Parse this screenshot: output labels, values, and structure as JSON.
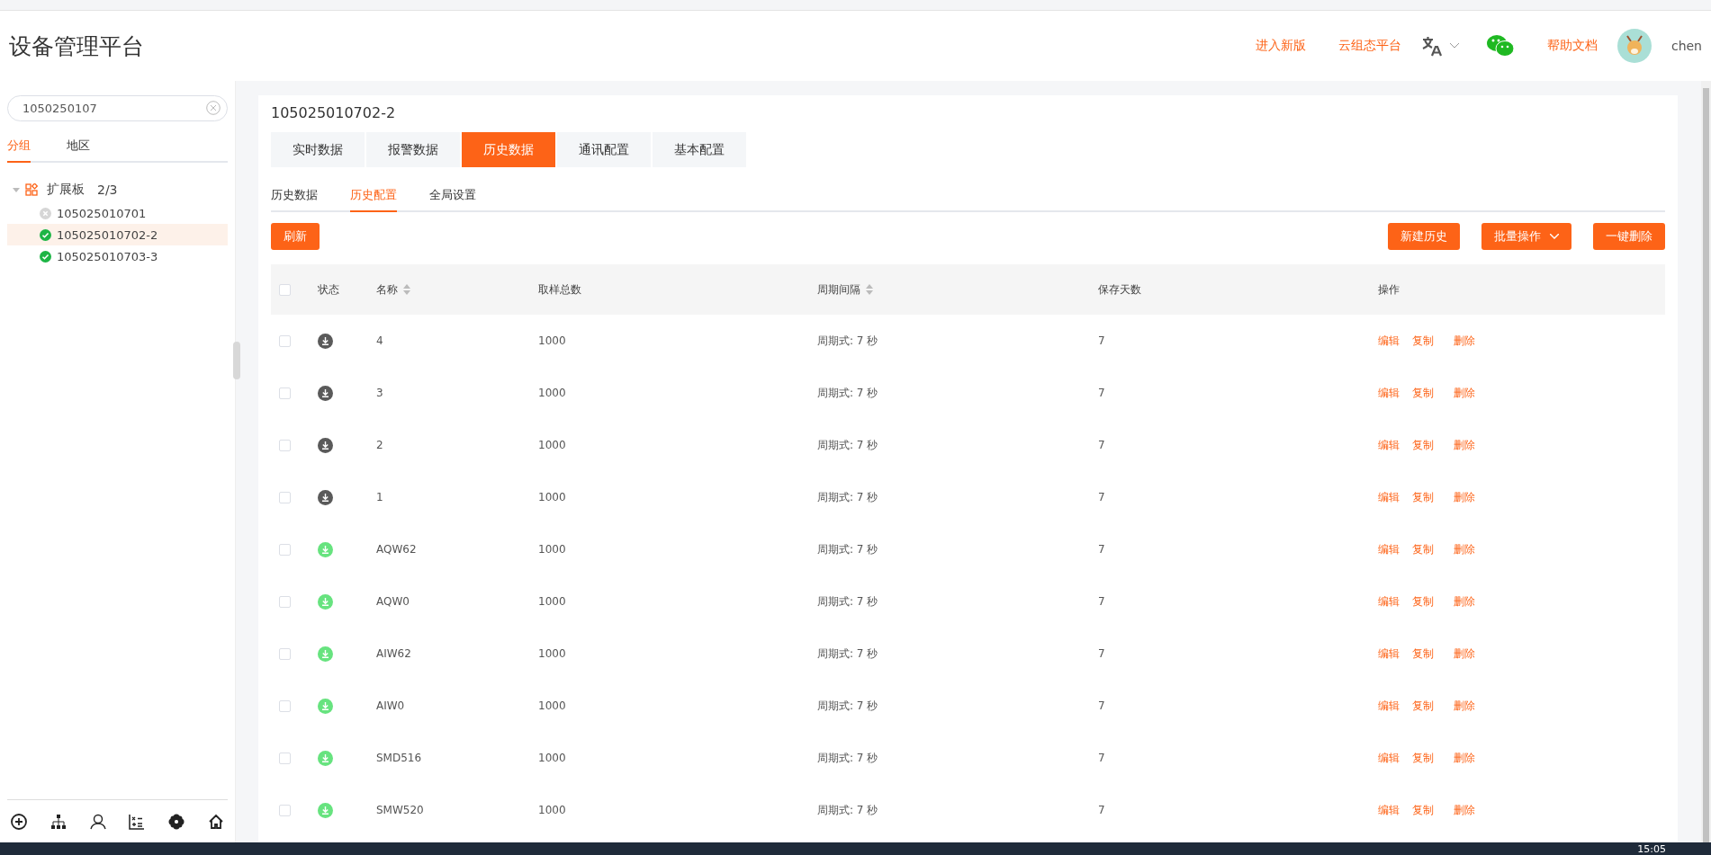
{
  "app_title": "设备管理平台",
  "header_links": [
    {
      "label": "进入新版"
    },
    {
      "label": "云组态平台"
    }
  ],
  "help_link": "帮助文档",
  "user": {
    "name": "chen"
  },
  "sidebar": {
    "search": {
      "value": "1050250107"
    },
    "tabs": [
      {
        "label": "分组",
        "selected": true
      },
      {
        "label": "地区",
        "selected": false
      }
    ],
    "tree": [
      {
        "label": "扩展板",
        "count": "2/3",
        "expanded": true,
        "children": [
          {
            "label": "105025010701",
            "online": false,
            "selected": false
          },
          {
            "label": "105025010702-2",
            "online": true,
            "selected": true
          },
          {
            "label": "105025010703-3",
            "online": true,
            "selected": false
          }
        ]
      }
    ]
  },
  "device_title": "105025010702-2",
  "tabs": [
    {
      "label": "实时数据",
      "selected": false
    },
    {
      "label": "报警数据",
      "selected": false
    },
    {
      "label": "历史数据",
      "selected": true
    },
    {
      "label": "通讯配置",
      "selected": false
    },
    {
      "label": "基本配置",
      "selected": false
    }
  ],
  "subtabs": [
    {
      "label": "历史数据",
      "selected": false
    },
    {
      "label": "历史配置",
      "selected": true
    },
    {
      "label": "全局设置",
      "selected": false
    }
  ],
  "refresh_button": "刷新",
  "right_buttons": [
    {
      "label": "新建历史",
      "kind": "plain"
    },
    {
      "label": "批量操作",
      "kind": "dropdown"
    },
    {
      "label": "一键删除",
      "kind": "plain"
    }
  ],
  "table": {
    "select_all_checked": false,
    "columns": [
      {
        "label": "状态",
        "sortable": false
      },
      {
        "label": "名称",
        "sortable": true
      },
      {
        "label": "取样总数",
        "sortable": false
      },
      {
        "label": "周期间隔",
        "sortable": true
      },
      {
        "label": "保存天数",
        "sortable": false
      },
      {
        "label": "操作",
        "sortable": false
      }
    ],
    "rows": [
      {
        "checked": false,
        "color": "#5a5a5a",
        "name": "4",
        "samples": "1000",
        "interval": "周期式: 7 秒",
        "days": "7",
        "actions": [
          "编辑",
          "复制",
          "删除"
        ]
      },
      {
        "checked": false,
        "color": "#5a5a5a",
        "name": "3",
        "samples": "1000",
        "interval": "周期式: 7 秒",
        "days": "7",
        "actions": [
          "编辑",
          "复制",
          "删除"
        ]
      },
      {
        "checked": false,
        "color": "#5a5a5a",
        "name": "2",
        "samples": "1000",
        "interval": "周期式: 7 秒",
        "days": "7",
        "actions": [
          "编辑",
          "复制",
          "删除"
        ]
      },
      {
        "checked": false,
        "color": "#5a5a5a",
        "name": "1",
        "samples": "1000",
        "interval": "周期式: 7 秒",
        "days": "7",
        "actions": [
          "编辑",
          "复制",
          "删除"
        ]
      },
      {
        "checked": false,
        "color": "#67e37f",
        "name": "AQW62",
        "samples": "1000",
        "interval": "周期式: 7 秒",
        "days": "7",
        "actions": [
          "编辑",
          "复制",
          "删除"
        ]
      },
      {
        "checked": false,
        "color": "#67e37f",
        "name": "AQW0",
        "samples": "1000",
        "interval": "周期式: 7 秒",
        "days": "7",
        "actions": [
          "编辑",
          "复制",
          "删除"
        ]
      },
      {
        "checked": false,
        "color": "#67e37f",
        "name": "AIW62",
        "samples": "1000",
        "interval": "周期式: 7 秒",
        "days": "7",
        "actions": [
          "编辑",
          "复制",
          "删除"
        ]
      },
      {
        "checked": false,
        "color": "#67e37f",
        "name": "AIW0",
        "samples": "1000",
        "interval": "周期式: 7 秒",
        "days": "7",
        "actions": [
          "编辑",
          "复制",
          "删除"
        ]
      },
      {
        "checked": false,
        "color": "#67e37f",
        "name": "SMD516",
        "samples": "1000",
        "interval": "周期式: 7 秒",
        "days": "7",
        "actions": [
          "编辑",
          "复制",
          "删除"
        ]
      },
      {
        "checked": false,
        "color": "#67e37f",
        "name": "SMW520",
        "samples": "1000",
        "interval": "周期式: 7 秒",
        "days": "7",
        "actions": [
          "编辑",
          "复制",
          "删除"
        ]
      }
    ]
  },
  "taskbar": {
    "clock": "15:05"
  }
}
